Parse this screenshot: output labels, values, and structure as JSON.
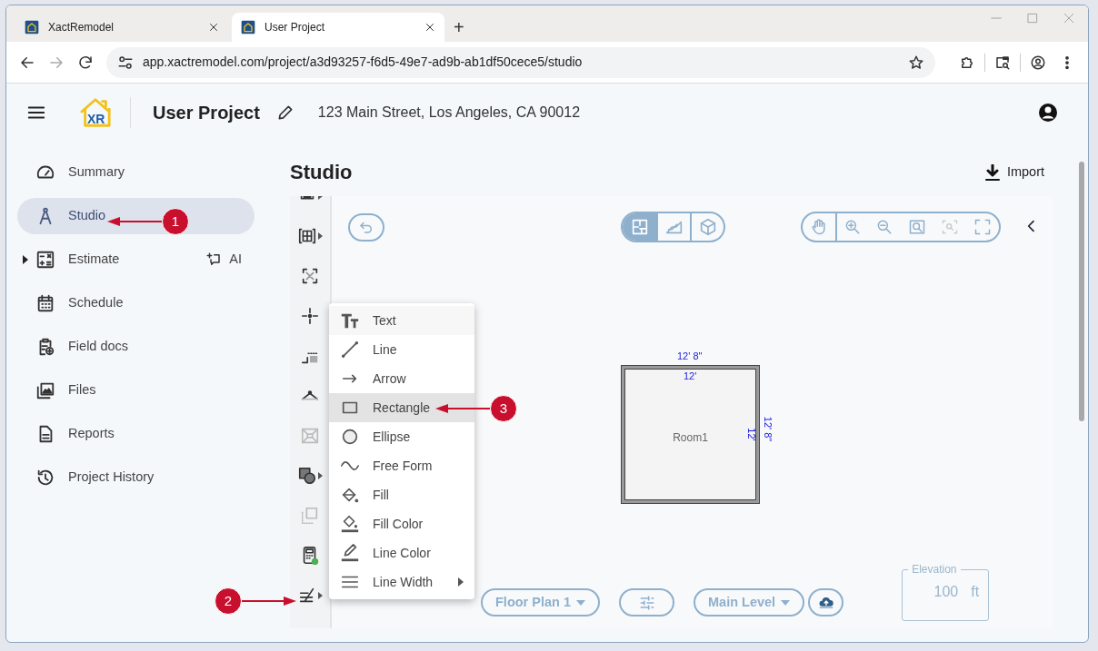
{
  "browser": {
    "tabs": [
      {
        "title": "XactRemodel",
        "selected": false
      },
      {
        "title": "User Project",
        "selected": true
      }
    ],
    "new_tab": "+",
    "url": "app.xactremodel.com/project/a3d93257-f6d5-49e7-ad9b-ab1df50cece5/studio"
  },
  "header": {
    "logo_text": "XR",
    "project_name": "User Project",
    "address": "123 Main Street, Los Angeles, CA 90012"
  },
  "sidebar": {
    "items": [
      {
        "label": "Summary",
        "selected": false,
        "expandable": false
      },
      {
        "label": "Studio",
        "selected": true,
        "expandable": false
      },
      {
        "label": "Estimate",
        "selected": false,
        "expandable": true,
        "ai_label": "AI"
      },
      {
        "label": "Schedule",
        "selected": false,
        "expandable": false
      },
      {
        "label": "Field docs",
        "selected": false,
        "expandable": false
      },
      {
        "label": "Files",
        "selected": false,
        "expandable": false
      },
      {
        "label": "Reports",
        "selected": false,
        "expandable": false
      },
      {
        "label": "Project History",
        "selected": false,
        "expandable": false
      }
    ]
  },
  "page": {
    "title": "Studio",
    "import_label": "Import"
  },
  "studio": {
    "tools": [
      {
        "submenu": true,
        "disabled": false
      },
      {
        "submenu": true,
        "disabled": false
      },
      {
        "submenu": false,
        "disabled": false
      },
      {
        "submenu": false,
        "disabled": false
      },
      {
        "submenu": false,
        "disabled": false
      },
      {
        "submenu": false,
        "disabled": false
      },
      {
        "submenu": false,
        "disabled": true
      },
      {
        "submenu": true,
        "disabled": false
      },
      {
        "submenu": false,
        "disabled": true
      },
      {
        "submenu": false,
        "disabled": false
      },
      {
        "submenu": true,
        "disabled": false
      }
    ],
    "view_modes": [
      {
        "selected": true
      },
      {
        "selected": false
      },
      {
        "selected": false
      }
    ],
    "zoom_tools": [
      {
        "disabled": false
      },
      {
        "disabled": false
      },
      {
        "disabled": false
      },
      {
        "disabled": false
      },
      {
        "disabled": true
      },
      {
        "disabled": false
      }
    ],
    "room": {
      "name": "Room1",
      "outer_width": "12' 8\"",
      "inner_width": "12'",
      "inner_height": "12'",
      "outer_height": "12' 8\""
    },
    "floor_plan": "Floor Plan 1",
    "level": "Main Level",
    "elevation": {
      "label": "Elevation",
      "value": "100",
      "unit": "ft"
    }
  },
  "context_menu": {
    "items": [
      {
        "label": "Text",
        "focused": true,
        "selected": false,
        "submenu": false
      },
      {
        "label": "Line",
        "focused": false,
        "selected": false,
        "submenu": false
      },
      {
        "label": "Arrow",
        "focused": false,
        "selected": false,
        "submenu": false
      },
      {
        "label": "Rectangle",
        "focused": false,
        "selected": true,
        "submenu": false
      },
      {
        "label": "Ellipse",
        "focused": false,
        "selected": false,
        "submenu": false
      },
      {
        "label": "Free Form",
        "focused": false,
        "selected": false,
        "submenu": false
      },
      {
        "label": "Fill",
        "focused": false,
        "selected": false,
        "submenu": false
      },
      {
        "label": "Fill Color",
        "focused": false,
        "selected": false,
        "submenu": false
      },
      {
        "label": "Line Color",
        "focused": false,
        "selected": false,
        "submenu": false
      },
      {
        "label": "Line Width",
        "focused": false,
        "selected": false,
        "submenu": true
      }
    ]
  },
  "callouts": [
    {
      "number": "1"
    },
    {
      "number": "2"
    },
    {
      "number": "3"
    }
  ]
}
